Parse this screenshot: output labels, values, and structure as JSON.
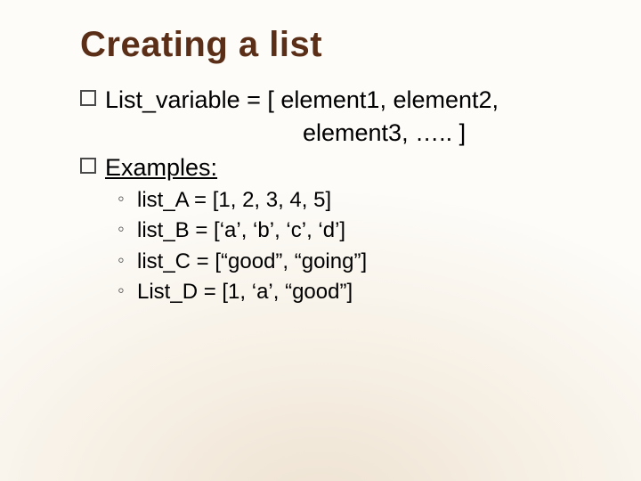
{
  "title": "Creating a list",
  "line1_a": "List_variable",
  "line1_b": " = [ element1, element2,",
  "line1_cont": "element3, ….. ]",
  "examples_label": "Examples:",
  "ex": [
    "list_A = [1, 2, 3, 4, 5]",
    "list_B = [‘a’, ‘b’, ‘c’, ‘d’]",
    "list_C = [“good”, “going”]",
    "List_D = [1, ‘a’, “good”]"
  ]
}
